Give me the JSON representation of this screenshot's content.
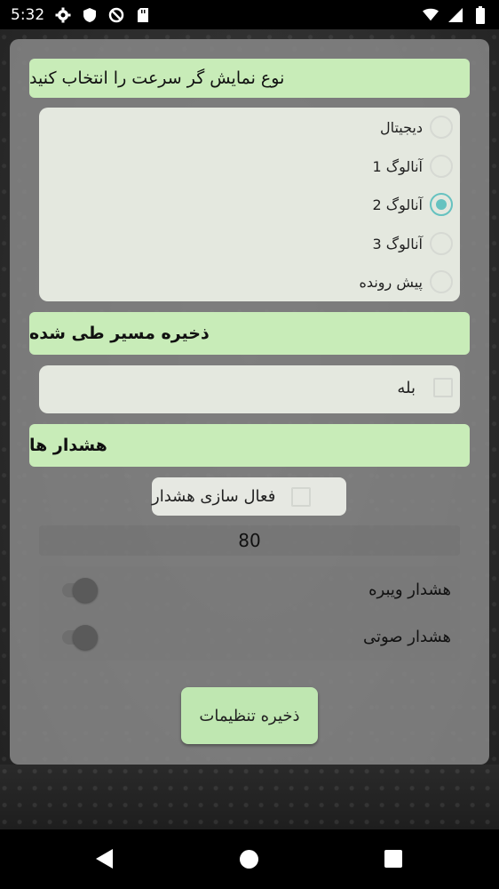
{
  "status_bar": {
    "time": "5:32",
    "icons": [
      "gear-icon",
      "shield-icon",
      "no-tracking-icon",
      "sd-card-icon"
    ],
    "right_icons": [
      "wifi-icon",
      "signal-icon",
      "battery-icon"
    ]
  },
  "speed_display": {
    "header": "نوع نمایش گر سرعت را انتخاب کنید",
    "options": [
      {
        "label": "دیجیتال",
        "checked": false
      },
      {
        "label": "آنالوگ 1",
        "checked": false
      },
      {
        "label": "آنالوگ 2",
        "checked": true
      },
      {
        "label": "آنالوگ 3",
        "checked": false
      },
      {
        "label": "پیش رونده",
        "checked": false
      }
    ]
  },
  "save_route": {
    "header": "ذخیره مسیر طی شده",
    "checkbox_label": "بله"
  },
  "alerts": {
    "header": "هشدار ها",
    "enable_label": "فعال سازی هشدار",
    "speed_value": "80",
    "vibrate_label": "هشدار ویبره",
    "sound_label": "هشدار صوتی"
  },
  "save_button_label": "ذخیره تنظیمات",
  "colors": {
    "header_green": "#c8ecb8",
    "radio_accent": "#66c2c0",
    "button_green": "#bfe7b1"
  }
}
